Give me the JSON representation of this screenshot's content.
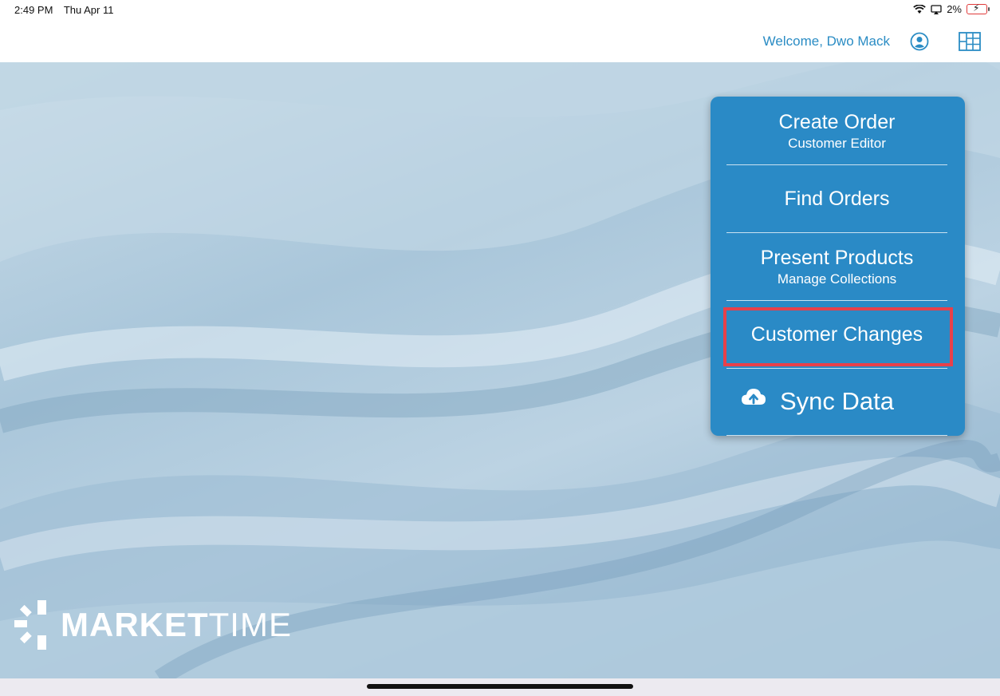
{
  "status_bar": {
    "time": "2:49 PM",
    "date": "Thu Apr 11",
    "battery_percent": "2%",
    "icons": [
      "wifi-icon",
      "screen-mirroring-icon",
      "battery-icon"
    ]
  },
  "header": {
    "welcome_text": "Welcome, Dwo Mack",
    "icons": [
      "user-icon",
      "grid-icon"
    ],
    "accent_color": "#2a8cc4"
  },
  "menu": {
    "background_color": "#2a8ac6",
    "highlight_color": "#e8404a",
    "items": [
      {
        "title": "Create Order",
        "subtitle": "Customer Editor"
      },
      {
        "title": "Find Orders",
        "subtitle": ""
      },
      {
        "title": "Present Products",
        "subtitle": "Manage Collections"
      },
      {
        "title": "Customer Changes",
        "subtitle": "",
        "highlighted": true
      },
      {
        "title": "Sync Data",
        "subtitle": "",
        "icon": "cloud-upload-icon"
      }
    ]
  },
  "logo": {
    "text_bold": "MARKET",
    "text_regular": "TIME"
  }
}
